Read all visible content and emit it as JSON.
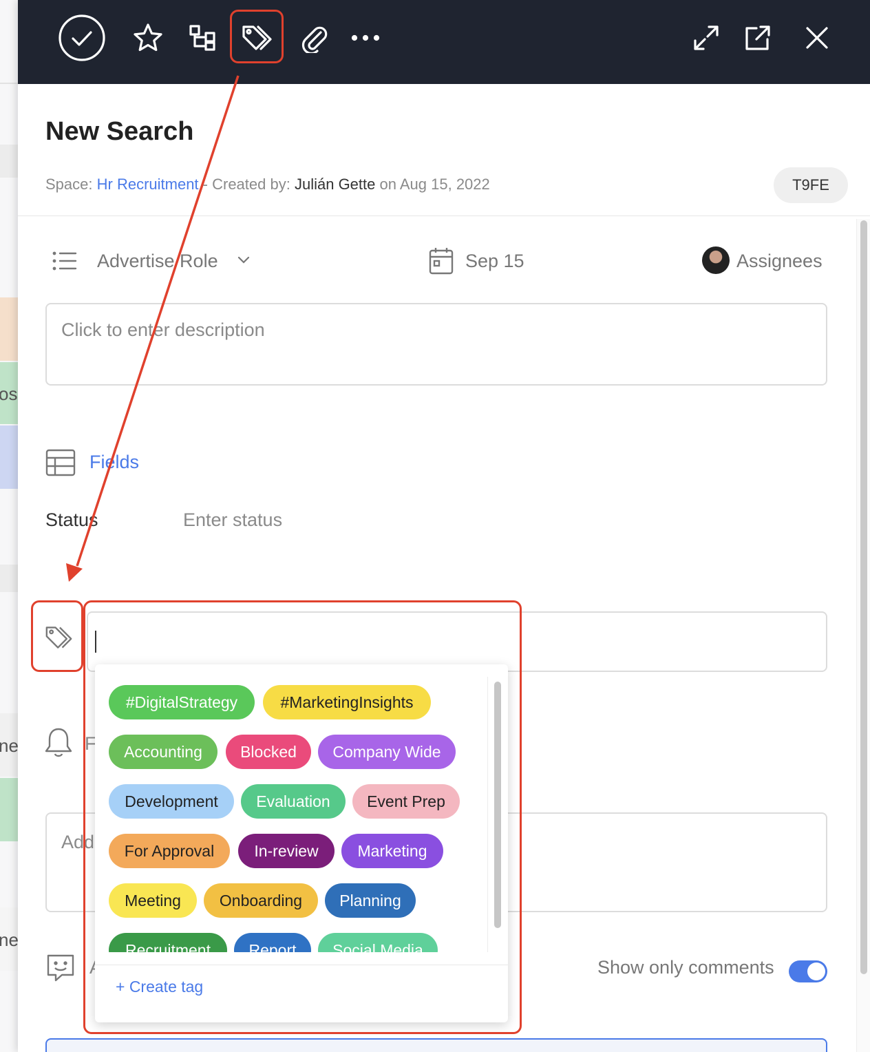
{
  "background": {
    "partial_texts": [
      "osi",
      "ne",
      "ne"
    ]
  },
  "toolbar": {
    "icons": [
      "check-circle-icon",
      "star-icon",
      "subtask-icon",
      "tag-icon",
      "paperclip-icon",
      "more-icon",
      "expand-icon",
      "open-external-icon",
      "close-icon"
    ]
  },
  "task": {
    "title": "New Search",
    "space_label": "Space:",
    "space_name": "Hr Recruitment",
    "created_label": "- Created by:",
    "creator": "Julián Gette",
    "created_on": "on Aug 15, 2022",
    "id": "T9FE"
  },
  "properties": {
    "list": "Advertise Role",
    "due_date": "Sep 15",
    "assignees": "Assignees"
  },
  "description": {
    "placeholder": "Click to enter description"
  },
  "fields": {
    "label": "Fields",
    "status_label": "Status",
    "status_placeholder": "Enter status"
  },
  "notifications": {
    "partial_label": "F"
  },
  "comment": {
    "partial_placeholder": "Add"
  },
  "activity": {
    "partial_label": "A",
    "show_only_comments": "Show only comments",
    "show_only_comments_on": true
  },
  "tag_dropdown": {
    "create_label": "+ Create tag",
    "tags": [
      {
        "label": "#DigitalStrategy",
        "bg": "#5ac85a",
        "fg": "#ffffff"
      },
      {
        "label": "#MarketingInsights",
        "bg": "#f7dc45",
        "fg": "#222222"
      },
      {
        "label": "Accounting",
        "bg": "#6cbf5a",
        "fg": "#ffffff"
      },
      {
        "label": "Blocked",
        "bg": "#ea4b7b",
        "fg": "#ffffff"
      },
      {
        "label": "Company Wide",
        "bg": "#a865e8",
        "fg": "#ffffff"
      },
      {
        "label": "Development",
        "bg": "#a6d0f7",
        "fg": "#222222"
      },
      {
        "label": "Evaluation",
        "bg": "#56c98a",
        "fg": "#ffffff"
      },
      {
        "label": "Event Prep",
        "bg": "#f4b7c0",
        "fg": "#222222"
      },
      {
        "label": "For Approval",
        "bg": "#f3a95a",
        "fg": "#222222"
      },
      {
        "label": "In-review",
        "bg": "#7b1e7a",
        "fg": "#ffffff"
      },
      {
        "label": "Marketing",
        "bg": "#8a4fe0",
        "fg": "#ffffff"
      },
      {
        "label": "Meeting",
        "bg": "#f9e653",
        "fg": "#222222"
      },
      {
        "label": "Onboarding",
        "bg": "#f2c043",
        "fg": "#222222"
      },
      {
        "label": "Planning",
        "bg": "#2f6fb8",
        "fg": "#ffffff"
      },
      {
        "label": "Recruitment",
        "bg": "#3a9a48",
        "fg": "#ffffff"
      },
      {
        "label": "Report",
        "bg": "#2f72c4",
        "fg": "#ffffff"
      },
      {
        "label": "Social Media",
        "bg": "#5fd09a",
        "fg": "#ffffff"
      }
    ]
  },
  "colors": {
    "toolbar_bg": "#1f2430",
    "accent": "#4a7ae8",
    "annotation": "#e0412d"
  }
}
